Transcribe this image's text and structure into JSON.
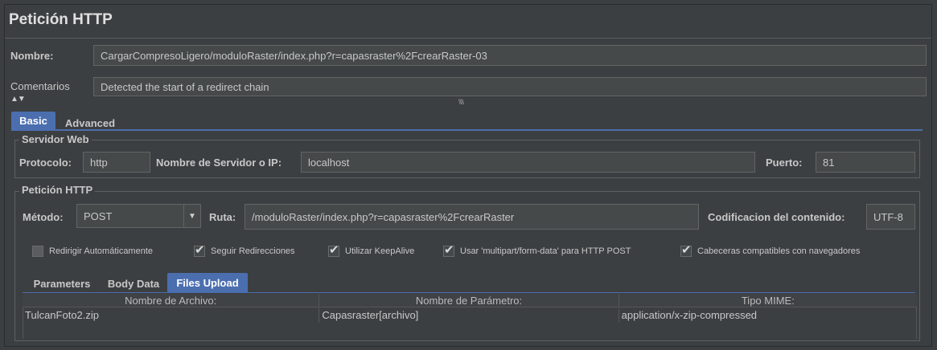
{
  "header": {
    "title": "Petición HTTP"
  },
  "form": {
    "name_label": "Nombre:",
    "name_value": "CargarCompresoLigero/moduloRaster/index.php?r=capasraster%2FcrearRaster-03",
    "comments_label": "Comentarios",
    "comments_value": "Detected the start of a redirect chain",
    "collapse_arrows": "▲▼",
    "divider_grip": "\\\\\\\\"
  },
  "tabs": [
    {
      "label": "Basic",
      "selected": true
    },
    {
      "label": "Advanced",
      "selected": false
    }
  ],
  "web_server": {
    "legend": "Servidor Web",
    "protocol_label": "Protocolo:",
    "protocol_value": "http",
    "server_label": "Nombre de Servidor o IP:",
    "server_value": "localhost",
    "port_label": "Puerto:",
    "port_value": "81"
  },
  "http_request": {
    "legend": "Petición HTTP",
    "method_label": "Método:",
    "method_value": "POST",
    "path_label": "Ruta:",
    "path_value": "/moduloRaster/index.php?r=capasraster%2FcrearRaster",
    "encoding_label": "Codificacion del contenido:",
    "encoding_value": "UTF-8"
  },
  "options": [
    {
      "label": "Redirigir Automáticamente",
      "checked": false
    },
    {
      "label": "Seguir Redirecciones",
      "checked": true
    },
    {
      "label": "Utilizar KeepAlive",
      "checked": true
    },
    {
      "label": "Usar 'multipart/form-data' para HTTP POST",
      "checked": true
    },
    {
      "label": "Cabeceras compatibles con navegadores",
      "checked": true
    }
  ],
  "subtabs": [
    {
      "label": "Parameters",
      "selected": false
    },
    {
      "label": "Body Data",
      "selected": false
    },
    {
      "label": "Files Upload",
      "selected": true
    }
  ],
  "files_table": {
    "headers": [
      "Nombre de Archivo:",
      "Nombre de Parámetro:",
      "Tipo MIME:"
    ],
    "rows": [
      [
        "TulcanFoto2.zip",
        "Capasraster[archivo]",
        "application/x-zip-compressed"
      ]
    ]
  },
  "colors": {
    "background": "#3c3f41",
    "field_background": "#45494a",
    "selected_tab": "#4b6eaf",
    "text": "#c8c8c8"
  }
}
